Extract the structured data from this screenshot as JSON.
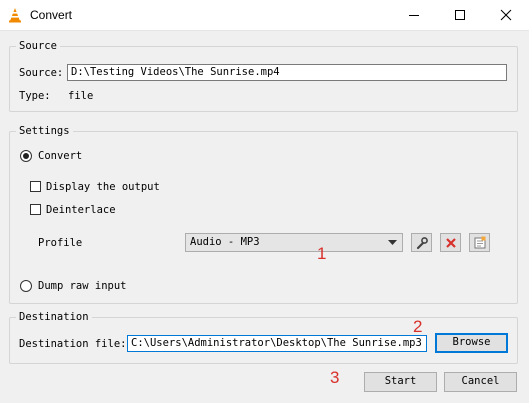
{
  "window": {
    "title": "Convert"
  },
  "source": {
    "legend": "Source",
    "source_label": "Source:",
    "source_value": "D:\\Testing Videos\\The Sunrise.mp4",
    "type_label": "Type:",
    "type_value": "file"
  },
  "settings": {
    "legend": "Settings",
    "convert_label": "Convert",
    "display_output_label": "Display the output",
    "deinterlace_label": "Deinterlace",
    "profile_label": "Profile",
    "profile_value": "Audio - MP3",
    "dump_raw_label": "Dump raw input"
  },
  "destination": {
    "legend": "Destination",
    "file_label": "Destination file:",
    "file_value": "C:\\Users\\Administrator\\Desktop\\The Sunrise.mp3",
    "browse_label": "Browse"
  },
  "actions": {
    "start_label": "Start",
    "cancel_label": "Cancel"
  },
  "markers": {
    "one": "1",
    "two": "2",
    "three": "3"
  },
  "colors": {
    "focus": "#0078d7",
    "marker": "#d8312c",
    "delete": "#d8312c"
  },
  "icons": [
    "vlc-cone-icon",
    "minimize-icon",
    "maximize-icon",
    "close-icon",
    "dropdown-arrow-icon",
    "wrench-icon",
    "delete-icon",
    "new-profile-icon"
  ]
}
